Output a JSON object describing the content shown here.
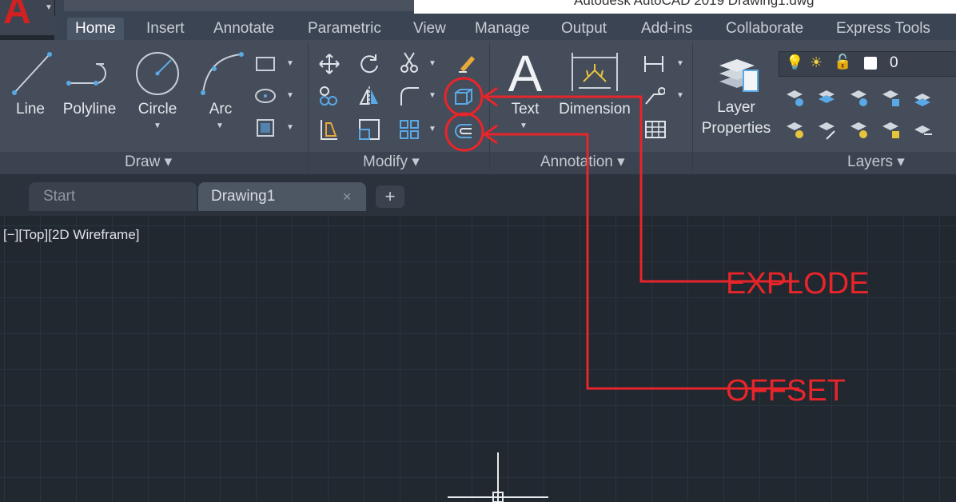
{
  "window": {
    "title": "Autodesk AutoCAD 2019    Drawing1.dwg",
    "app_logo": "A"
  },
  "ribbon": {
    "tabs": [
      {
        "label": "Home"
      },
      {
        "label": "Insert"
      },
      {
        "label": "Annotate"
      },
      {
        "label": "Parametric"
      },
      {
        "label": "View"
      },
      {
        "label": "Manage"
      },
      {
        "label": "Output"
      },
      {
        "label": "Add-ins"
      },
      {
        "label": "Collaborate"
      },
      {
        "label": "Express Tools"
      }
    ],
    "active_tab": "Home",
    "draw": {
      "line": "Line",
      "polyline": "Polyline",
      "circle": "Circle",
      "arc": "Arc",
      "panel_title": "Draw ▾"
    },
    "modify": {
      "panel_title": "Modify ▾"
    },
    "annotation": {
      "text": "Text",
      "dimension": "Dimension",
      "panel_title": "Annotation ▾"
    },
    "layers": {
      "layer_properties_line1": "Layer",
      "layer_properties_line2": "Properties",
      "current_layer": "0",
      "panel_title": "Layers ▾"
    }
  },
  "file_tabs": {
    "start": "Start",
    "drawing": "Drawing1",
    "close_glyph": "✕",
    "new_glyph": "+"
  },
  "viewport": {
    "label": "[−][Top][2D Wireframe]"
  },
  "callouts": {
    "explode": "EXPLODE",
    "offset": "OFFSET"
  },
  "colors": {
    "accent_red": "#e8252a",
    "ribbon_bg": "#454d5a",
    "canvas_bg": "#212830"
  }
}
